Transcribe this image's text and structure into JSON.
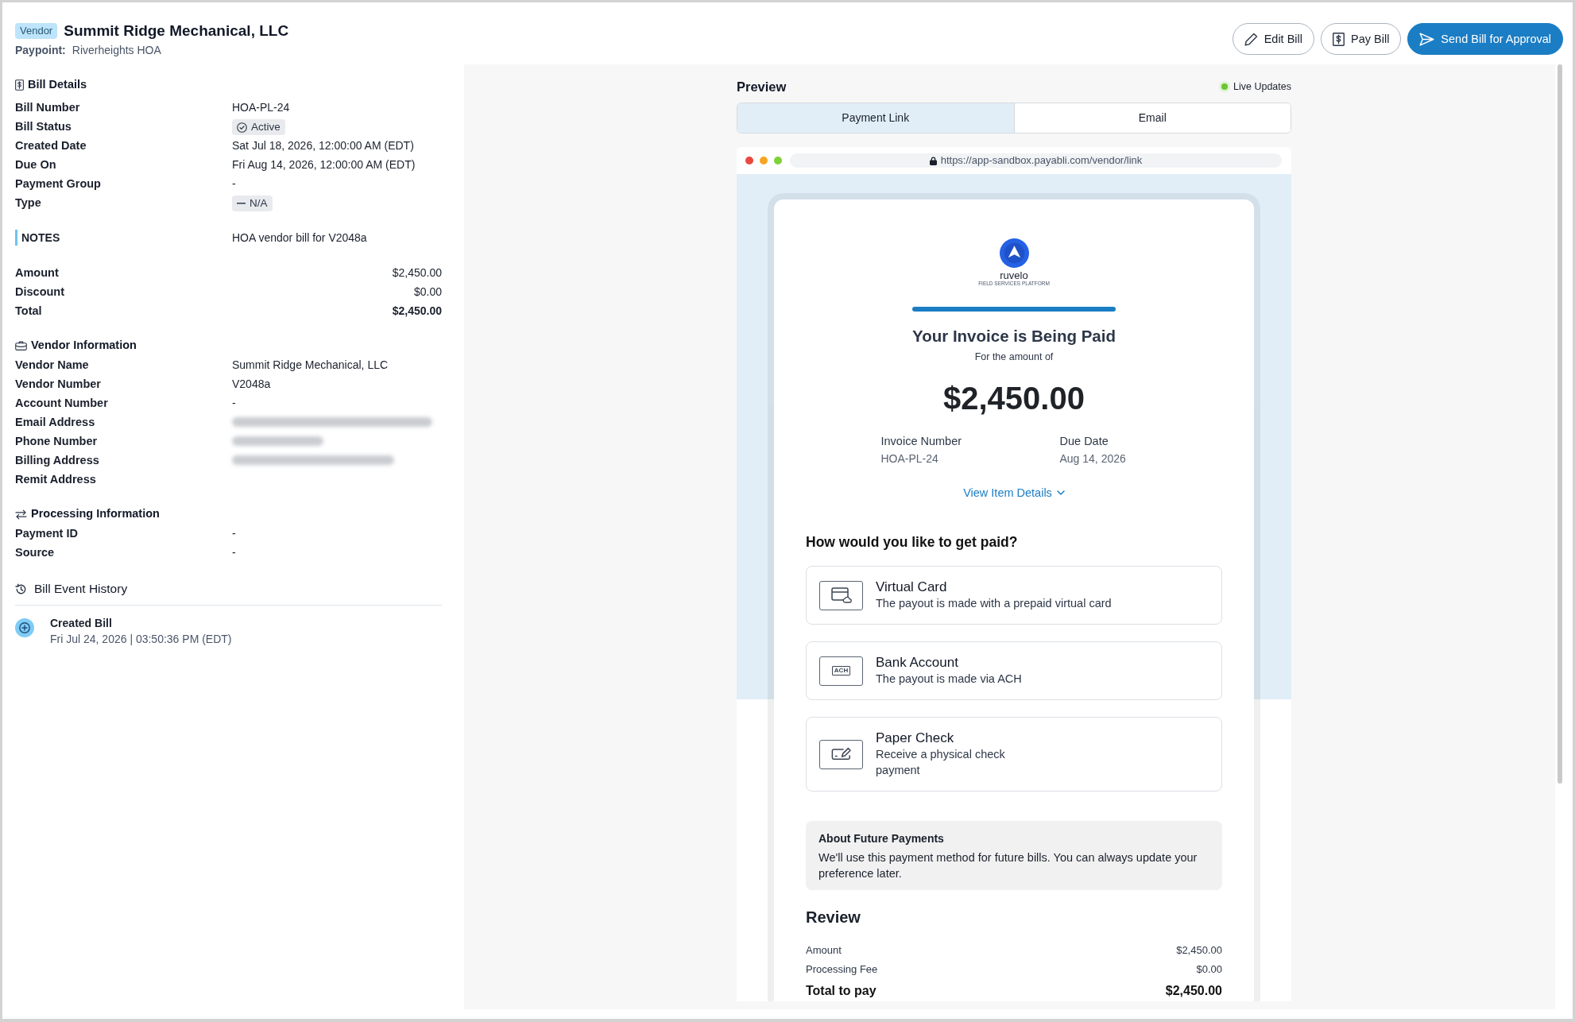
{
  "header": {
    "badge": "Vendor",
    "title": "Summit Ridge Mechanical, LLC",
    "paypoint_label": "Paypoint:",
    "paypoint": "Riverheights HOA"
  },
  "actions": [
    {
      "label": "Edit Bill",
      "kind": "edit"
    },
    {
      "label": "Pay Bill",
      "kind": "pay"
    },
    {
      "label": "Send Bill for Approval",
      "kind": "send"
    }
  ],
  "bill_details": {
    "title": "Bill Details",
    "rows": [
      {
        "label": "Bill Number",
        "value": "HOA-PL-24",
        "kind": "text"
      },
      {
        "label": "Bill Status",
        "value": "Active",
        "kind": "status"
      },
      {
        "label": "Created Date",
        "value": "Sat Jul 18, 2026, 12:00:00 AM (EDT)",
        "kind": "text"
      },
      {
        "label": "Due On",
        "value": "Fri Aug 14, 2026, 12:00:00 AM (EDT)",
        "kind": "text"
      },
      {
        "label": "Payment Group",
        "value": "-",
        "kind": "text"
      },
      {
        "label": "Type",
        "value": "N/A",
        "kind": "tag"
      }
    ]
  },
  "notes": {
    "label": "NOTES",
    "value": "HOA vendor bill for V2048a"
  },
  "totals": [
    {
      "label": "Amount",
      "value": "$2,450.00",
      "kind": "line"
    },
    {
      "label": "Discount",
      "value": "$0.00",
      "kind": "line"
    },
    {
      "label": "Total",
      "value": "$2,450.00",
      "kind": "total"
    }
  ],
  "vendor_information": {
    "title": "Vendor Information",
    "rows": [
      {
        "label": "Vendor Name",
        "value": "Summit Ridge Mechanical, LLC",
        "kind": "text"
      },
      {
        "label": "Vendor Number",
        "value": "V2048a",
        "kind": "text"
      },
      {
        "label": "Account Number",
        "value": "-",
        "kind": "text"
      },
      {
        "label": "Email Address",
        "kind": "blurred"
      },
      {
        "label": "Phone Number",
        "kind": "blurred"
      },
      {
        "label": "Billing Address",
        "kind": "blurred"
      },
      {
        "label": "Remit Address",
        "kind": "empty"
      }
    ]
  },
  "processing_information": {
    "title": "Processing Information",
    "rows": [
      {
        "label": "Payment ID",
        "value": "-",
        "kind": "text"
      },
      {
        "label": "Source",
        "value": "-",
        "kind": "text"
      }
    ]
  },
  "event_history": {
    "title": "Bill Event History",
    "events": [
      {
        "title": "Created Bill",
        "time": "Fri Jul 24, 2026 | 03:50:36 PM (EDT)"
      }
    ]
  },
  "preview": {
    "title": "Preview",
    "live_label": "Live Updates",
    "tabs": [
      {
        "label": "Payment Link",
        "selected": true
      },
      {
        "label": "Email",
        "selected": false
      }
    ],
    "url": "https://app-sandbox.payabli.com/vendor/link",
    "page": {
      "brand": "ruvelo",
      "tagline": "FIELD SERVICES PLATFORM",
      "heading": "Your Invoice is Being Paid",
      "subheading": "For the amount of",
      "amount": "$2,450.00",
      "meta": [
        {
          "label": "Invoice Number",
          "value": "HOA-PL-24"
        },
        {
          "label": "Due Date",
          "value": "Aug 14, 2026"
        }
      ],
      "details_link": "View Item Details",
      "question": "How would you like to get paid?",
      "options": [
        {
          "kind": "card",
          "title": "Virtual Card",
          "description": "The payout is made with a prepaid virtual card",
          "selected": false
        },
        {
          "kind": "ach",
          "icon_text": "ACH",
          "title": "Bank Account",
          "description": "The payout is made via ACH",
          "selected": false
        },
        {
          "kind": "check",
          "title": "Paper Check",
          "description": "Receive a physical check payment",
          "selected": false
        }
      ],
      "note": {
        "title": "About Future Payments",
        "text": "We'll use this payment method for future bills. You can always update your preference later."
      },
      "review": {
        "title": "Review",
        "rows": [
          {
            "label": "Amount",
            "value": "$2,450.00",
            "kind": "line"
          },
          {
            "label": "Processing Fee",
            "value": "$0.00",
            "kind": "line"
          },
          {
            "label": "Total to pay",
            "value": "$2,450.00",
            "kind": "total"
          }
        ]
      }
    }
  }
}
